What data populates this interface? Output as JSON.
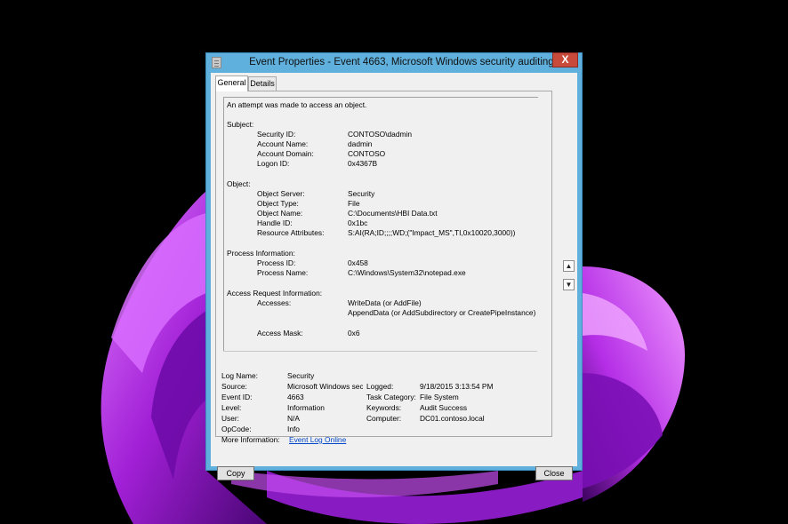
{
  "window": {
    "title": "Event Properties - Event 4663, Microsoft Windows security auditing.",
    "close_label": "X"
  },
  "tabs": [
    {
      "label": "General",
      "active": true
    },
    {
      "label": "Details",
      "active": false
    }
  ],
  "message": {
    "intro": "An attempt was made to access an object.",
    "subject": {
      "heading": "Subject:",
      "security_id_label": "Security ID:",
      "security_id": "CONTOSO\\dadmin",
      "account_name_label": "Account Name:",
      "account_name": "dadmin",
      "account_domain_label": "Account Domain:",
      "account_domain": "CONTOSO",
      "logon_id_label": "Logon ID:",
      "logon_id": "0x4367B"
    },
    "object": {
      "heading": "Object:",
      "server_label": "Object Server:",
      "server": "Security",
      "type_label": "Object Type:",
      "type": "File",
      "name_label": "Object Name:",
      "name": "C:\\Documents\\HBI Data.txt",
      "handle_label": "Handle ID:",
      "handle": "0x1bc",
      "attributes_label": "Resource Attributes:",
      "attributes": "S:AI(RA;ID;;;;WD;(\"Impact_MS\",TI,0x10020,3000))"
    },
    "process": {
      "heading": "Process Information:",
      "id_label": "Process ID:",
      "id": "0x458",
      "name_label": "Process Name:",
      "name": "C:\\Windows\\System32\\notepad.exe"
    },
    "access": {
      "heading": "Access Request Information:",
      "accesses_label": "Accesses:",
      "accesses_1": "WriteData (or AddFile)",
      "accesses_2": "AppendData (or AddSubdirectory or CreatePipeInstance)",
      "mask_label": "Access Mask:",
      "mask": "0x6"
    }
  },
  "details": {
    "log_name_label": "Log Name:",
    "log_name": "Security",
    "source_label": "Source:",
    "source": "Microsoft Windows security auditing.",
    "logged_label": "Logged:",
    "logged": "9/18/2015 3:13:54 PM",
    "event_id_label": "Event ID:",
    "event_id": "4663",
    "task_category_label": "Task Category:",
    "task_category": "File System",
    "level_label": "Level:",
    "level": "Information",
    "keywords_label": "Keywords:",
    "keywords": "Audit Success",
    "user_label": "User:",
    "user": "N/A",
    "computer_label": "Computer:",
    "computer": "DC01.contoso.local",
    "opcode_label": "OpCode:",
    "opcode": "Info",
    "more_info_label": "More Information:",
    "more_info_link": "Event Log Online"
  },
  "buttons": {
    "copy": "Copy",
    "close": "Close"
  },
  "colors": {
    "title_bar": "#5fb0dc",
    "close_button": "#c74a3b",
    "link": "#0046c8",
    "wallpaper_accent": "#b02ee0"
  }
}
